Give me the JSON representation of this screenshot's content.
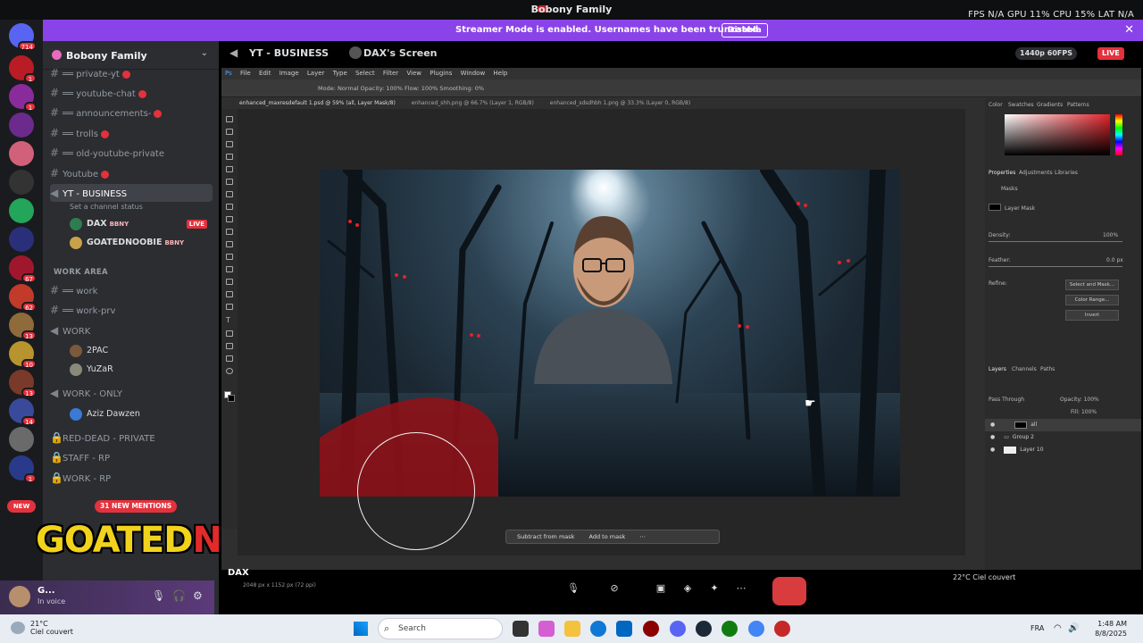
{
  "titlebar": {
    "title": "Bobony Family",
    "stats": "FPS N/A   GPU 11%   CPU 15%   LAT N/A"
  },
  "banner": {
    "message": "Streamer Mode is enabled. Usernames have been truncated.",
    "button": "Disable"
  },
  "server": {
    "name": "Bobony Family",
    "rail_badges": [
      "714",
      "1",
      "1",
      "67",
      "62",
      "13",
      "10",
      "13",
      "14",
      "1"
    ],
    "new_label": "NEW"
  },
  "channels": {
    "items": [
      {
        "label": "══ private-yt",
        "dot": true
      },
      {
        "label": "══ youtube-chat",
        "dot": true
      },
      {
        "label": "══ announcements-",
        "dot": true
      },
      {
        "label": "══ trolls",
        "dot": true
      },
      {
        "label": "══ old-youtube-private",
        "dot": false
      },
      {
        "label": "Youtube",
        "dot": true
      }
    ],
    "active": {
      "label": "YT - BUSINESS",
      "status": "Set a channel status"
    },
    "voice_users": [
      {
        "name": "DAX",
        "tag": "BBNY",
        "live": "LIVE"
      },
      {
        "name": "GOATEDNOOBIE",
        "tag": "BBNY"
      }
    ],
    "category_work": "WORK AREA",
    "work_items": [
      "══ work",
      "══ work-prv",
      "WORK"
    ],
    "work_users": [
      "2PAC",
      "YuZaR"
    ],
    "only_items": [
      "WORK - ONLY"
    ],
    "only_user": "Aziz Dawzen",
    "private_items": [
      "RED-DEAD - PRIVATE",
      "STAFF - RP",
      "WORK - RP"
    ],
    "mentions": "31 NEW MENTIONS"
  },
  "overlay_logo": {
    "part1": "GOATED",
    "part2": "NOOBIE"
  },
  "userbar": {
    "name": "G...",
    "status": "In voice"
  },
  "stream": {
    "channel": "YT - BUSINESS",
    "screen": "DAX's Screen",
    "quality": "1440p 60FPS",
    "live": "LIVE",
    "user_label": "DAX"
  },
  "photoshop": {
    "menu": [
      "File",
      "Edit",
      "Image",
      "Layer",
      "Type",
      "Select",
      "Filter",
      "View",
      "Plugins",
      "Window",
      "Help"
    ],
    "options": "Mode: Normal    Opacity: 100%    Flow: 100%    Smoothing: 0%",
    "tabs": [
      "enhanced_maxresdefault 1.psd @ 59% (all, Layer Mask/8)",
      "enhanced_shh.png @ 66.7% (Layer 1, RGB/8)",
      "enhanced_sdsdhbh 1.png @ 33.3% (Layer 0, RGB/8)"
    ],
    "right_tabs": [
      "Color",
      "Swatches",
      "Gradients",
      "Patterns"
    ],
    "props_tabs": [
      "Properties",
      "Adjustments",
      "Libraries"
    ],
    "props": {
      "masks": "Masks",
      "layer_mask": "Layer Mask",
      "density": "Density:",
      "density_val": "100%",
      "feather": "Feather:",
      "feather_val": "0.0 px",
      "refine": "Refine:"
    },
    "prop_buttons": [
      "Select and Mask...",
      "Color Range...",
      "Invert"
    ],
    "layers_tabs": [
      "Layers",
      "Channels",
      "Paths"
    ],
    "layers": [
      "all",
      "Group 2",
      "Layer 10"
    ],
    "blend": "Pass Through",
    "opacity": "Opacity: 100%",
    "fill": "Fill: 100%",
    "mask_bar": [
      "Subtract from mask",
      "Add to mask"
    ],
    "status": "2048 px x 1152 px (72 ppi)"
  },
  "taskbar": {
    "temp": "21°C",
    "weather": "Ciel couvert",
    "search": "Search",
    "lang": "FRA",
    "time": "1:48 AM",
    "date": "8/8/2025",
    "stream_weather": "22°C  Ciel couvert"
  },
  "colors": {
    "accent": "#8a43e8",
    "live": "#e3323d",
    "sidebar": "#2b2d31"
  }
}
